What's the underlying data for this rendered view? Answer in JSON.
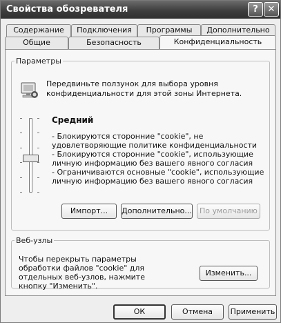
{
  "window": {
    "title": "Свойства обозревателя",
    "help_glyph": "?",
    "close_glyph": "✕"
  },
  "tabs_back": [
    "Содержание",
    "Подключения",
    "Программы",
    "Дополнительно"
  ],
  "tabs_front": [
    "Общие",
    "Безопасность",
    "Конфиденциальность"
  ],
  "params_group": {
    "legend": "Параметры",
    "intro": "Передвиньте ползунок для выбора уровня конфиденциальности для этой зоны Интернета.",
    "level_name": "Средний",
    "slider_level": "3 of 6",
    "descriptions": [
      "- Блокируются сторонние \"cookie\", не удовлетворяющие политике конфиденциальности",
      "- Блокируются сторонние \"cookie\", использующие личную информацию без вашего явного согласия",
      "- Ограничиваются основные \"cookie\", использующие личную информацию без вашего явного согласия"
    ],
    "import_btn": "Импорт...",
    "advanced_btn": "Дополнительно...",
    "default_btn": "По умолчанию"
  },
  "sites_group": {
    "legend": "Веб-узлы",
    "text": "Чтобы перекрыть параметры обработки файлов \"cookie\" для отдельных веб-узлов, нажмите кнопку \"Изменить\".",
    "edit_btn": "Изменить..."
  },
  "footer": {
    "ok_btn": "ОК",
    "cancel_btn": "Отмена",
    "apply_btn": "Применить"
  }
}
